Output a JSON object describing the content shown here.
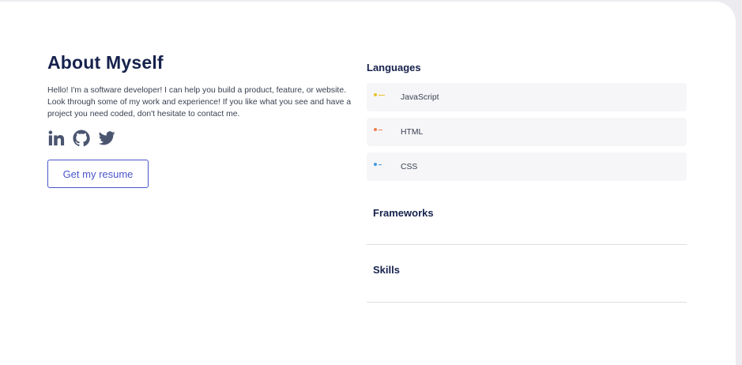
{
  "about": {
    "heading": "About Myself",
    "bio": "Hello! I'm a software developer! I can help you build a product, feature, or website. Look through some of my work and experience! If you like what you see and have a project you need coded, don't hesitate to contact me.",
    "socials": [
      {
        "icon": "linkedin-icon"
      },
      {
        "icon": "github-icon"
      },
      {
        "icon": "twitter-icon"
      }
    ],
    "resume_button": "Get my resume"
  },
  "skills_panel": {
    "languages_title": "Languages",
    "languages": [
      {
        "name": "JavaScript",
        "color": "#e8c22a",
        "icon": "javascript-icon"
      },
      {
        "name": "HTML",
        "color": "#f07c4c",
        "icon": "html-icon"
      },
      {
        "name": "CSS",
        "color": "#3f9ae6",
        "icon": "css-icon"
      }
    ],
    "frameworks_title": "Frameworks",
    "skills_title": "Skills"
  },
  "colors": {
    "heading": "#16224d",
    "accent": "#4a56c9",
    "social_icon": "#4b5570"
  }
}
